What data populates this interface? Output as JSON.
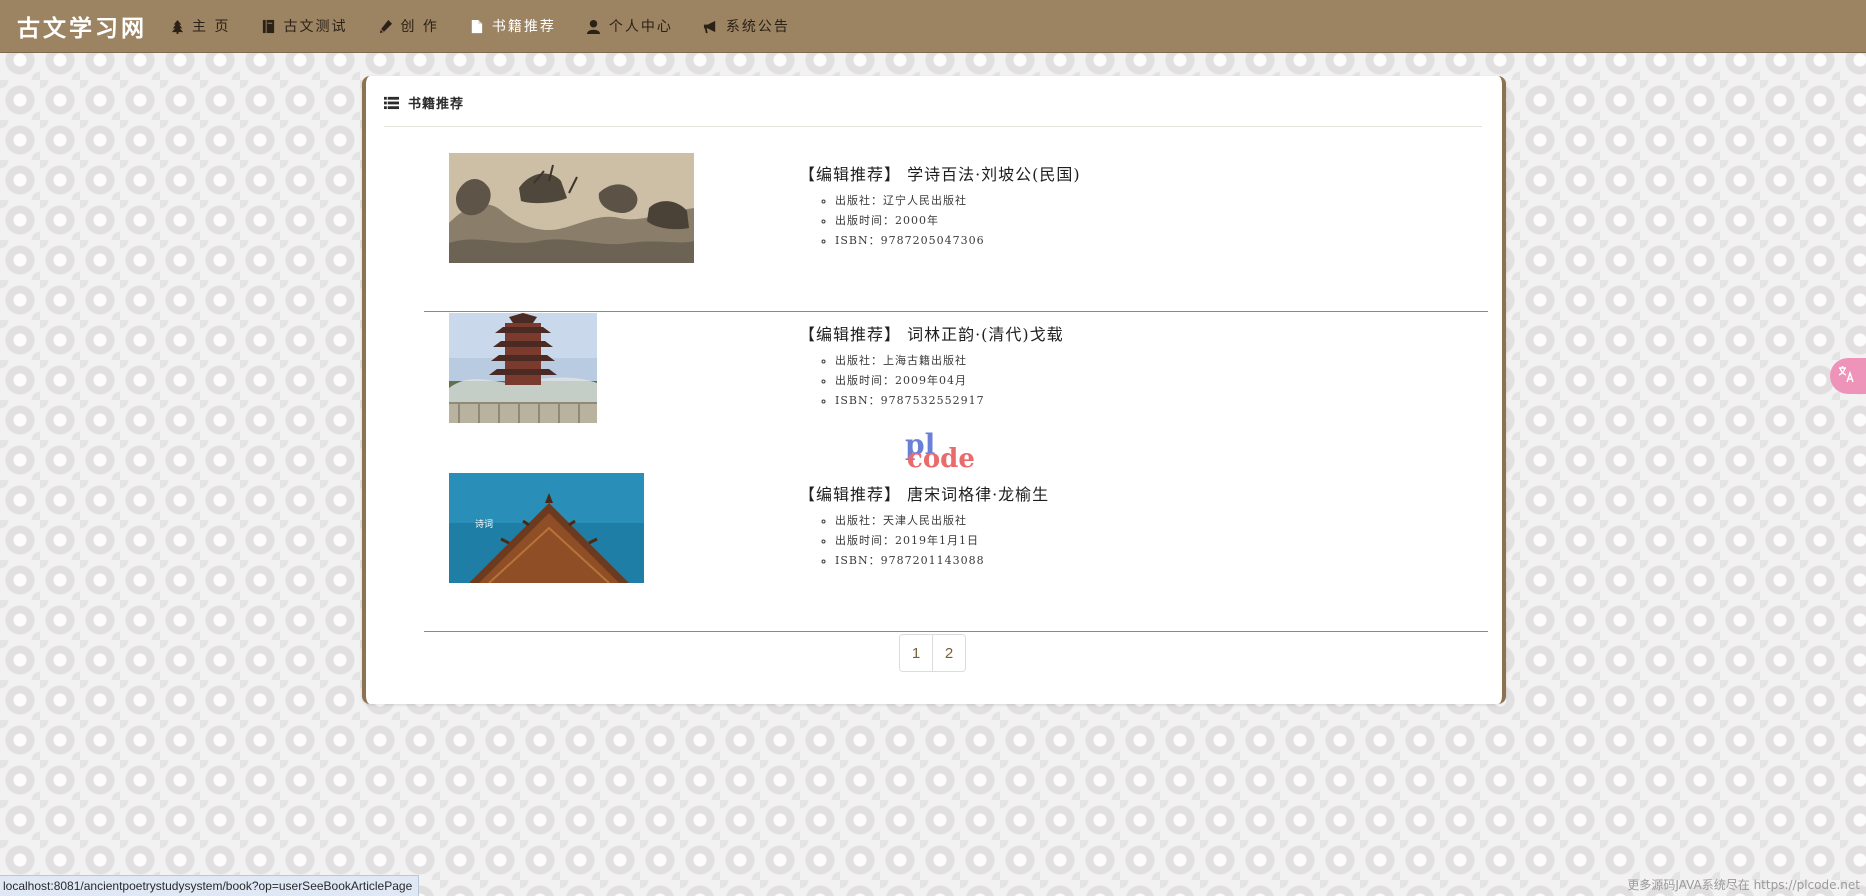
{
  "navbar": {
    "brand": "古文学习网",
    "items": [
      {
        "label": "主  页",
        "icon": "tree-icon"
      },
      {
        "label": "古文测试",
        "icon": "book-icon"
      },
      {
        "label": "创  作",
        "icon": "pencil-icon"
      },
      {
        "label": "书籍推荐",
        "icon": "file-icon",
        "active": true
      },
      {
        "label": "个人中心",
        "icon": "user-icon"
      },
      {
        "label": "系统公告",
        "icon": "bullhorn-icon"
      }
    ]
  },
  "panel": {
    "title": "书籍推荐",
    "icon": "list-icon"
  },
  "books": [
    {
      "title": "【编辑推荐】 学诗百法·刘坡公(民国)",
      "publisher": "出版社：辽宁人民出版社",
      "date": "出版时间：2000年",
      "isbn": "ISBN：9787205047306",
      "cover_icon": "landscape-painting-image"
    },
    {
      "title": "【编辑推荐】 词林正韵·(清代)戈载",
      "publisher": "出版社：上海古籍出版社",
      "date": "出版时间：2009年04月",
      "isbn": "ISBN：9787532552917",
      "cover_icon": "yellow-crane-tower-image"
    },
    {
      "title": "【编辑推荐】 唐宋词格律·龙榆生",
      "publisher": "出版社：天津人民出版社",
      "date": "出版时间：2019年1月1日",
      "isbn": "ISBN：9787201143088",
      "cover_icon": "palace-roof-image"
    }
  ],
  "pagination": {
    "pages": [
      "1",
      "2"
    ]
  },
  "watermark": {
    "line1": "pl",
    "line2": "code"
  },
  "status_bar": {
    "url": "localhost:8081/ancientpoetrystudysystem/book?op=userSeeBookArticlePage"
  },
  "footer": {
    "note": "更多源码JAVA系统尽在 https://plcode.net"
  },
  "side_widget": {
    "icon": "translate-icon"
  },
  "colors": {
    "navbar": "#9c8463",
    "panel_border": "#8b7351",
    "page_number": "#7a5f3a"
  }
}
